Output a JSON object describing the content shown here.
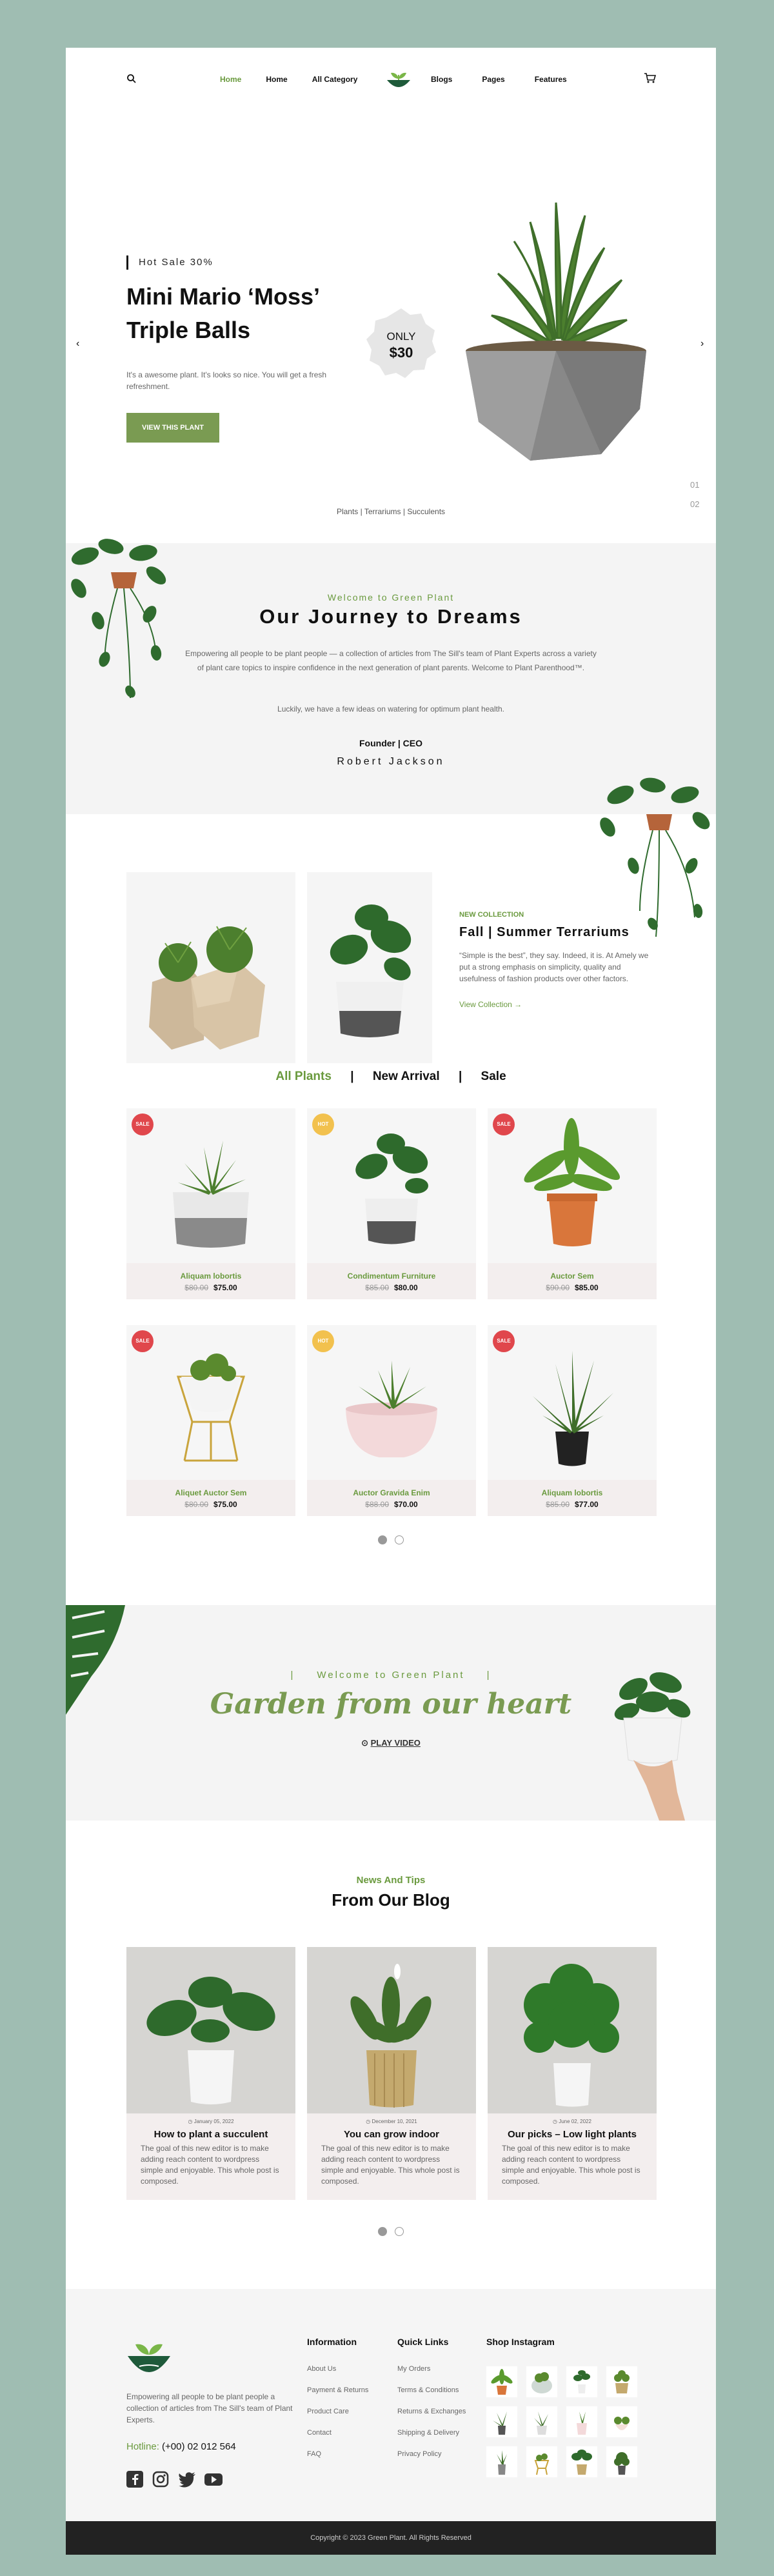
{
  "nav": {
    "left_items": [
      "Home",
      "Home",
      "All Category"
    ],
    "right_items": [
      "Blogs",
      "Pages",
      "Features"
    ]
  },
  "hero": {
    "tag": "Hot Sale 30%",
    "title": "Mini Mario ‘Moss’ Triple Balls",
    "desc": "It's a awesome plant. It's looks so nice. You will get a fresh refreshment.",
    "button": "VIEW THIS PLANT",
    "badge_top": "ONLY",
    "badge_price": "$30",
    "categories": "Plants | Terrariums | Succulents",
    "page1": "01",
    "page2": "02"
  },
  "journey": {
    "sub": "Welcome to Green Plant",
    "title": "Our Journey to Dreams",
    "p1": "Empowering all people to be plant people — a collection of articles from The Sill's team of Plant Experts across a variety of plant care topics to inspire confidence in the next generation of plant parents. Welcome to Plant Parenthood™.",
    "p2": "Luckily, we have a few ideas on watering for optimum plant health.",
    "role": "Founder | CEO",
    "name": "Robert Jackson"
  },
  "collection": {
    "kicker": "NEW COLLECTION",
    "title": "Fall | Summer Terrariums",
    "text": "“Simple is the best”, they say. Indeed, it is. At Amely we put a strong emphasis on simplicity, quality and usefulness of fashion products over other factors.",
    "link": "View Collection →"
  },
  "tabs": [
    "All Plants",
    "New Arrival",
    "Sale"
  ],
  "products": [
    {
      "name": "Aliquam lobortis",
      "old": "$80.00",
      "new": "$75.00",
      "badge": "SALE",
      "badge_color": "#e0474c"
    },
    {
      "name": "Condimentum Furniture",
      "old": "$85.00",
      "new": "$80.00",
      "badge": "HOT",
      "badge_color": "#f2c14e"
    },
    {
      "name": "Auctor Sem",
      "old": "$90.00",
      "new": "$85.00",
      "badge": "SALE",
      "badge_color": "#e0474c"
    },
    {
      "name": "Aliquet Auctor Sem",
      "old": "$80.00",
      "new": "$75.00",
      "badge": "SALE",
      "badge_color": "#e0474c"
    },
    {
      "name": "Auctor Gravida Enim",
      "old": "$88.00",
      "new": "$70.00",
      "badge": "HOT",
      "badge_color": "#f2c14e"
    },
    {
      "name": "Aliquam lobortis",
      "old": "$85.00",
      "new": "$77.00",
      "badge": "SALE",
      "badge_color": "#e0474c"
    }
  ],
  "garden": {
    "sub": "Welcome to Green Plant",
    "title": "Garden from our heart",
    "play": "PLAY VIDEO"
  },
  "blog": {
    "kicker": "News And Tips",
    "title": "From Our Blog",
    "posts": [
      {
        "date": "January 05, 2022",
        "title": "How to plant a succulent",
        "excerpt": "The goal of this new editor is to make adding reach content to wordpress simple and enjoyable. This whole post is composed."
      },
      {
        "date": "December 10, 2021",
        "title": "You can grow indoor",
        "excerpt": "The goal of this new editor is to make adding reach content to wordpress simple and enjoyable. This whole post is composed."
      },
      {
        "date": "June 02, 2022",
        "title": "Our picks – Low light plants",
        "excerpt": "The goal of this new editor is to make adding reach content to wordpress simple and enjoyable. This whole post is composed."
      }
    ]
  },
  "footer": {
    "desc": "Empowering all people to be plant people a collection of articles from The Sill's team of Plant Experts.",
    "hotline_label": "Hotline:",
    "hotline_number": "(+00) 02 012 564",
    "info_title": "Information",
    "info_links": [
      "About Us",
      "Payment & Returns",
      "Product Care",
      "Contact",
      "FAQ"
    ],
    "quick_title": "Quick Links",
    "quick_links": [
      "My Orders",
      "Terms & Conditions",
      "Returns & Exchanges",
      "Shipping & Delivery",
      "Privacy Policy"
    ],
    "insta_title": "Shop Instagram",
    "copyright": "Copyright © 2023 Green Plant. All Rights Reserved"
  },
  "colors": {
    "accent": "#6a9a3e",
    "button": "#7a9b52",
    "background": "#9fbdb2",
    "sale": "#e0474c",
    "hot": "#f2c14e"
  }
}
